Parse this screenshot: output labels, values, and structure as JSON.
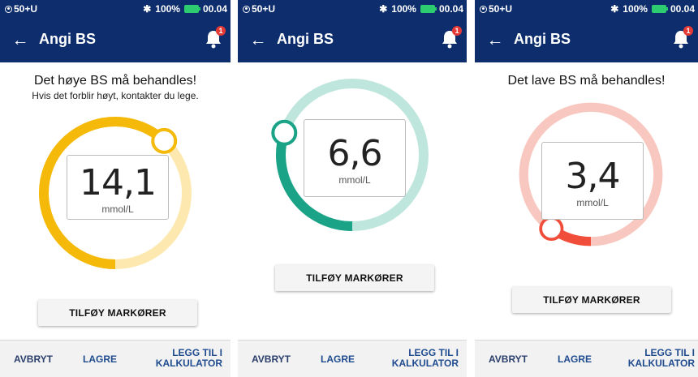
{
  "status": {
    "carrier": "50+U",
    "battery": "100%",
    "time": "00.04"
  },
  "appbar": {
    "title": "Angi BS",
    "notification_count": "1"
  },
  "screens": [
    {
      "heading": "Det høye BS må behandles!",
      "subheading": "Hvis det forblir høyt, kontakter du lege.",
      "value": "14,1",
      "unit": "mmol/L",
      "gauge_level": 0.62,
      "colors": {
        "track": "#fde9b0",
        "active": "#f5b90a"
      }
    },
    {
      "heading": "",
      "subheading": "",
      "value": "6,6",
      "unit": "mmol/L",
      "gauge_level": 0.3,
      "colors": {
        "track": "#bfe6dc",
        "active": "#1aa386"
      }
    },
    {
      "heading": "Det lave BS må behandles!",
      "subheading": "",
      "value": "3,4",
      "unit": "mmol/L",
      "gauge_level": 0.1,
      "colors": {
        "track": "#f8c8c0",
        "active": "#f04e3a"
      }
    }
  ],
  "actions": {
    "add_markers": "TILFØY MARKØRER",
    "cancel": "AVBRYT",
    "save": "LAGRE",
    "add_calc_line1": "LEGG TIL I",
    "add_calc_line2": "KALKULATOR"
  }
}
